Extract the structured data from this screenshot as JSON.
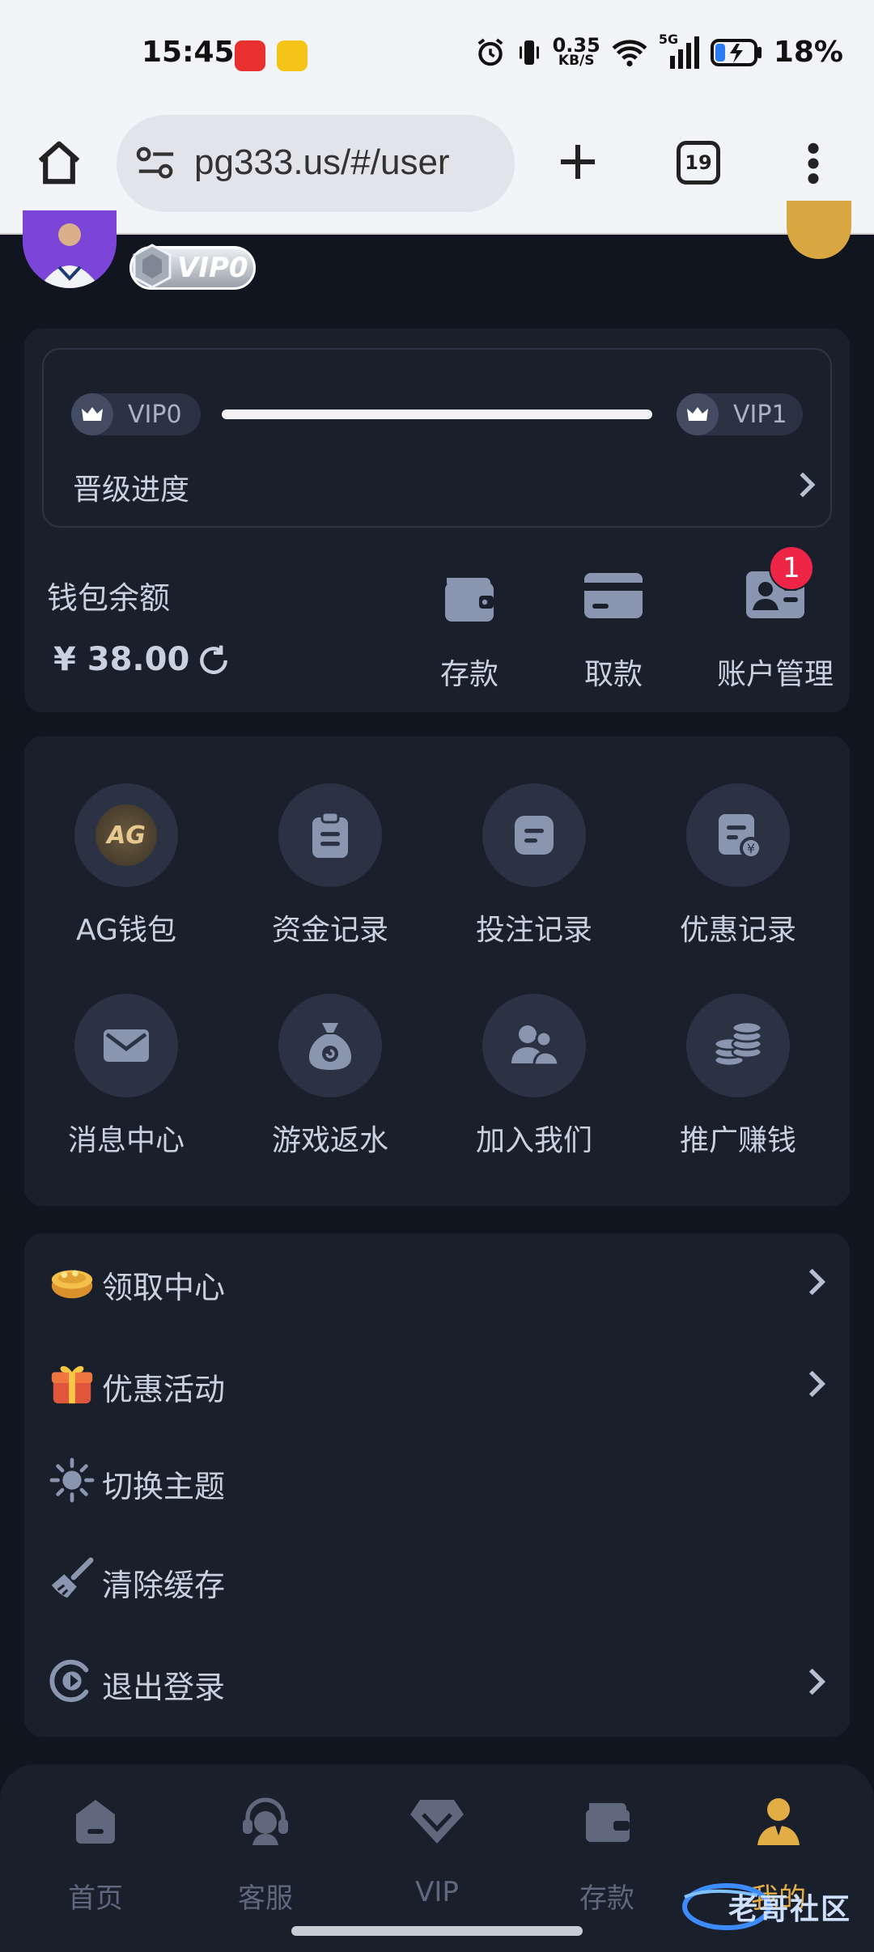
{
  "status_bar": {
    "time": "15:45",
    "net_speed": "0.35",
    "net_unit": "KB/S",
    "network_type": "5G",
    "battery": "18%"
  },
  "browser": {
    "url": "pg333.us/#/user",
    "tab_count": "19"
  },
  "profile": {
    "vip_badge": "VIP0"
  },
  "vip_progress": {
    "current_level": "VIP0",
    "next_level": "VIP1",
    "label": "晋级进度",
    "progress": 1.0
  },
  "wallet": {
    "label": "钱包余额",
    "amount": "¥ 38.00",
    "actions": [
      {
        "label": "存款",
        "icon": "wallet-icon"
      },
      {
        "label": "取款",
        "icon": "card-icon"
      },
      {
        "label": "账户管理",
        "icon": "id-card-icon",
        "badge": "1"
      }
    ]
  },
  "grid": [
    {
      "label": "AG钱包",
      "icon": "ag-wallet-logo-icon",
      "logo_text": "AG"
    },
    {
      "label": "资金记录",
      "icon": "clipboard-icon"
    },
    {
      "label": "投注记录",
      "icon": "note-icon"
    },
    {
      "label": "优惠记录",
      "icon": "discount-doc-icon"
    },
    {
      "label": "消息中心",
      "icon": "mail-icon"
    },
    {
      "label": "游戏返水",
      "icon": "money-bag-icon"
    },
    {
      "label": "加入我们",
      "icon": "users-icon"
    },
    {
      "label": "推广赚钱",
      "icon": "coin-stack-icon"
    }
  ],
  "menu": [
    {
      "label": "领取中心",
      "icon": "gold-pot-icon",
      "chevron": true
    },
    {
      "label": "优惠活动",
      "icon": "gift-box-icon",
      "chevron": true
    },
    {
      "label": "切换主题",
      "icon": "sun-icon",
      "chevron": false
    },
    {
      "label": "清除缓存",
      "icon": "broom-icon",
      "chevron": false
    },
    {
      "label": "退出登录",
      "icon": "logout-icon",
      "chevron": true
    }
  ],
  "bottom_nav": [
    {
      "label": "首页",
      "icon": "home-icon",
      "active": false
    },
    {
      "label": "客服",
      "icon": "headset-icon",
      "active": false
    },
    {
      "label": "VIP",
      "icon": "diamond-icon",
      "active": false
    },
    {
      "label": "存款",
      "icon": "wallet-icon",
      "active": false
    },
    {
      "label": "我的",
      "icon": "user-icon",
      "active": true
    }
  ],
  "watermark": "老哥社区",
  "colors": {
    "background": "#11151f",
    "card": "#1a1f2c",
    "circle": "#2b3244",
    "text": "#c9d1e0",
    "accent": "#e2ad45",
    "badge": "#ef2548"
  }
}
